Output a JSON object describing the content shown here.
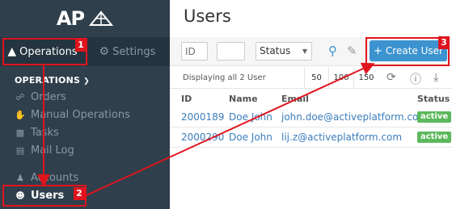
{
  "app": {
    "logo_text": "AP"
  },
  "sidebar": {
    "tabs": [
      {
        "label": "Operations",
        "icon": "bag-icon"
      },
      {
        "label": "Settings",
        "icon": "gear-icon"
      }
    ],
    "section_title": "OPERATIONS",
    "items": [
      {
        "label": "Orders",
        "icon": "cart-icon"
      },
      {
        "label": "Manual Operations",
        "icon": "hand-icon"
      },
      {
        "label": "Tasks",
        "icon": "briefcase-icon"
      },
      {
        "label": "Mail Log",
        "icon": "document-icon"
      },
      {
        "label": "Accounts",
        "icon": "accounts-icon"
      },
      {
        "label": "Users",
        "icon": "users-icon"
      }
    ]
  },
  "main": {
    "title": "Users",
    "filters": {
      "id_placeholder": "ID",
      "second_placeholder": "",
      "status_value": "Status"
    },
    "create_button": "Create User",
    "pager": {
      "summary": "Displaying all 2 User",
      "sizes": [
        "50",
        "100",
        "150"
      ]
    },
    "table": {
      "headers": [
        "ID",
        "Name",
        "Email",
        "Status"
      ],
      "rows": [
        {
          "id": "2000189",
          "name": "Doe John I",
          "email": "john.doe@activeplatform.com",
          "status": "active"
        },
        {
          "id": "2000290",
          "name": "Doe John",
          "email": "lij.z@activeplatform.com",
          "status": "active"
        }
      ]
    }
  },
  "annotations": [
    "1",
    "2",
    "3"
  ],
  "colors": {
    "sidebar_bg": "#2f3f4c",
    "accent": "#3c93d0",
    "highlight": "#e0141d",
    "status_active": "#5cb85c"
  }
}
